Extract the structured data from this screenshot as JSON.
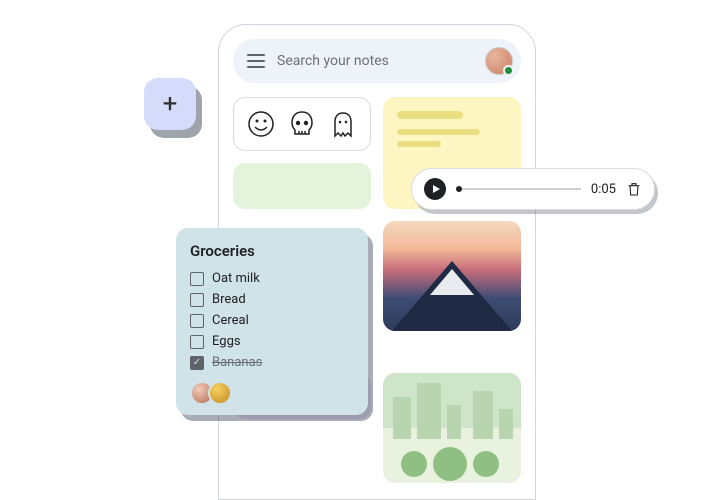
{
  "search": {
    "placeholder": "Search your notes"
  },
  "fab": {
    "glyph": "+"
  },
  "audio": {
    "time": "0:05"
  },
  "groceries": {
    "title": "Groceries",
    "items": [
      {
        "label": "Oat milk",
        "done": false
      },
      {
        "label": "Bread",
        "done": false
      },
      {
        "label": "Cereal",
        "done": false
      },
      {
        "label": "Eggs",
        "done": false
      },
      {
        "label": "Bananas",
        "done": true
      }
    ]
  },
  "colors": {
    "yellow": "#fdf6c3",
    "green": "#e3f3dc",
    "blue": "#cfe3e9",
    "lilac": "#e9e1f7",
    "fab": "#d5dcfb"
  }
}
